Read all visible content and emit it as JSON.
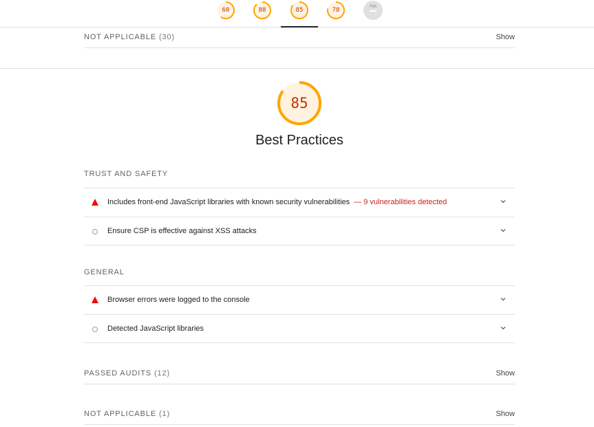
{
  "header": {
    "gauges": [
      {
        "name": "performance",
        "score": "60",
        "fraction": 0.6
      },
      {
        "name": "accessibility",
        "score": "88",
        "fraction": 0.88
      },
      {
        "name": "best-practices",
        "score": "85",
        "fraction": 0.85
      },
      {
        "name": "seo",
        "score": "78",
        "fraction": 0.78
      },
      {
        "name": "pwa",
        "score": "PWA",
        "fraction": 0
      }
    ]
  },
  "previous_section": {
    "not_applicable": {
      "label": "NOT APPLICABLE",
      "count": "(30)",
      "show": "Show"
    }
  },
  "category": {
    "score": "85",
    "fraction": 0.85,
    "title": "Best Practices"
  },
  "groups": [
    {
      "title": "TRUST AND SAFETY",
      "audits": [
        {
          "status": "fail",
          "title": "Includes front-end JavaScript libraries with known security vulnerabilities",
          "display": "— 9 vulnerabilities detected"
        },
        {
          "status": "info",
          "title": "Ensure CSP is effective against XSS attacks",
          "display": ""
        }
      ]
    },
    {
      "title": "GENERAL",
      "audits": [
        {
          "status": "fail",
          "title": "Browser errors were logged to the console",
          "display": ""
        },
        {
          "status": "info",
          "title": "Detected JavaScript libraries",
          "display": ""
        }
      ]
    }
  ],
  "passed_audits": {
    "label": "PASSED AUDITS",
    "count": "(12)",
    "show": "Show"
  },
  "not_applicable": {
    "label": "NOT APPLICABLE",
    "count": "(1)",
    "show": "Show"
  },
  "colors": {
    "average": "#ffa400",
    "average_text": "#c33300",
    "fail": "#eb0f00",
    "na": "#e0e0e0"
  }
}
